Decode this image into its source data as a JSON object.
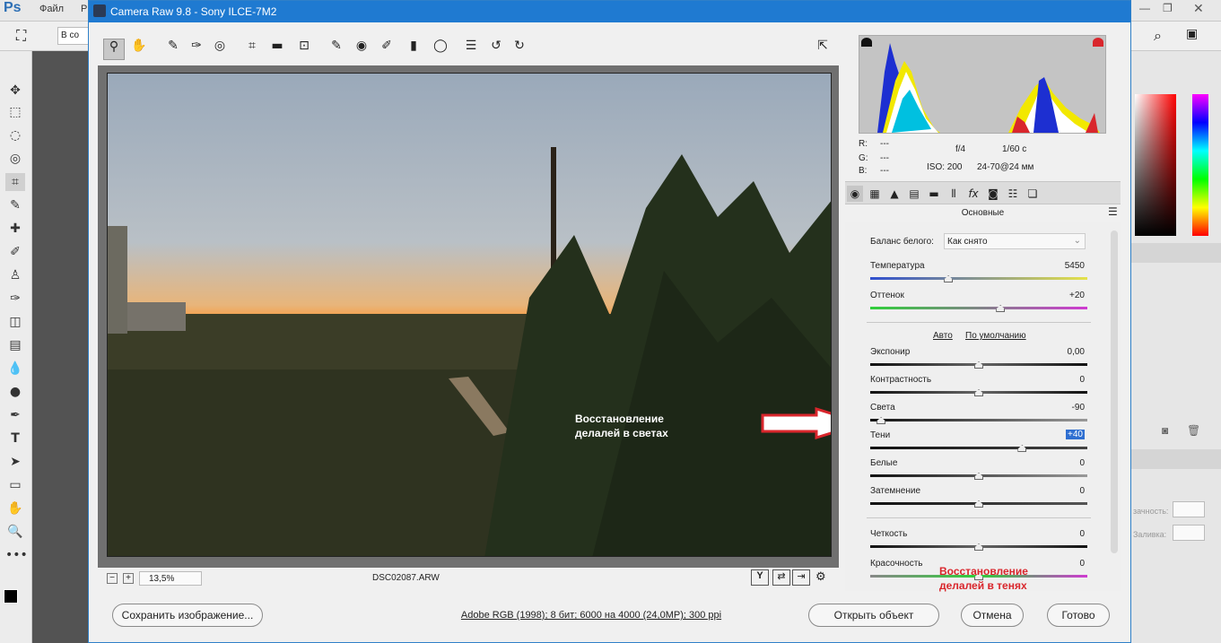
{
  "ps": {
    "logo": "Ps",
    "menus": [
      "Файл",
      "Р"
    ],
    "option_text": "В со"
  },
  "dialog": {
    "title": "Camera Raw 9.8  -  Sony ILCE-7M2"
  },
  "preview": {
    "zoom": "13,5%",
    "filename": "DSC02087.ARW",
    "annotation_highlights": "Восстановление делалей в светах",
    "annotation_shadows": "Восстановление делалей в тенях"
  },
  "info": {
    "r_label": "R:",
    "r_value": "---",
    "g_label": "G:",
    "g_value": "---",
    "b_label": "B:",
    "b_value": "---",
    "aperture": "f/4",
    "shutter": "1/60 с",
    "iso": "ISO: 200",
    "lens": "24-70@24 мм"
  },
  "panel": {
    "title": "Основные",
    "wb_label": "Баланс белого:",
    "wb_value": "Как снято",
    "auto": "Авто",
    "default": "По умолчанию",
    "sliders": [
      {
        "label": "Температура",
        "value": "5450",
        "level": 0.36
      },
      {
        "label": "Оттенок",
        "value": "+20",
        "level": 0.6
      },
      {
        "label": "Экспонир",
        "value": "0,00",
        "level": 0.5
      },
      {
        "label": "Контрастность",
        "value": "0",
        "level": 0.5
      },
      {
        "label": "Света",
        "value": "-90",
        "level": 0.05
      },
      {
        "label": "Тени",
        "value": "+40",
        "level": 0.7
      },
      {
        "label": "Белые",
        "value": "0",
        "level": 0.5
      },
      {
        "label": "Затемнение",
        "value": "0",
        "level": 0.5
      },
      {
        "label": "Четкость",
        "value": "0",
        "level": 0.5
      },
      {
        "label": "Красочность",
        "value": "0",
        "level": 0.5
      }
    ]
  },
  "footer": {
    "save": "Сохранить изображение...",
    "workflow": "Adobe RGB (1998); 8 бит; 6000 на 4000 (24,0МР); 300 ppi",
    "open": "Открыть объект",
    "cancel": "Отмена",
    "done": "Готово"
  },
  "right_panel": {
    "opacity_label": "зачность:",
    "fill_label": "Заливка:"
  },
  "colors": {
    "title_bar": "#1f7ad1",
    "arrow_red": "#d9262c",
    "annotation_white": "#ffffff",
    "annotation_red": "#d9262c"
  }
}
